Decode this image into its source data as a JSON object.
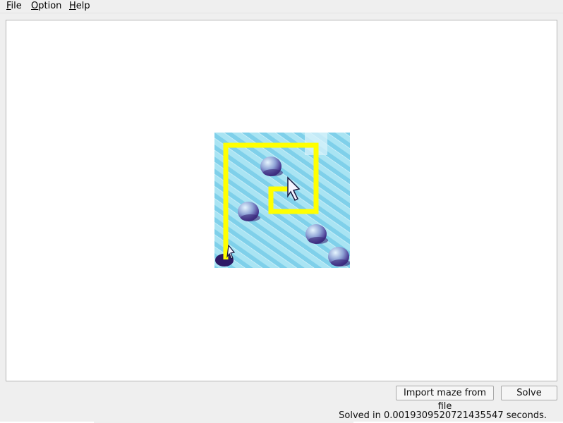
{
  "menubar": {
    "items": [
      {
        "label": "File"
      },
      {
        "label": "Option"
      },
      {
        "label": "Help"
      }
    ]
  },
  "maze": {
    "grid": "6x6",
    "tiles": [
      "ice",
      "boulder",
      "exit",
      "hole"
    ],
    "boulders": [
      "r1c2",
      "r3c1",
      "r4c4",
      "r5c5"
    ],
    "start": "r5c0",
    "exit": "r0c4",
    "solution_path": "yellow",
    "colors": {
      "ice": "#a9e4f3",
      "ice_stripe": "#76cde8",
      "boulder": "#7e92c8",
      "boulder_dark": "#2e1a66",
      "path": "#ffff00"
    }
  },
  "controls": {
    "import_label": "Import maze from file",
    "solve_label": "Solve"
  },
  "status": {
    "message": "Solved in 0.0019309520721435547 seconds."
  }
}
